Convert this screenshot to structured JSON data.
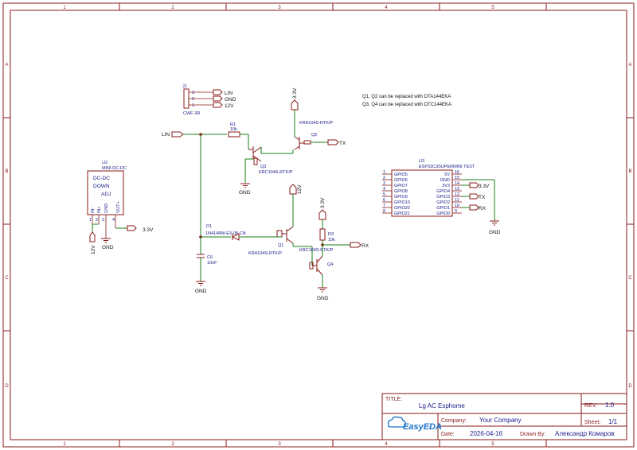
{
  "zones": {
    "cols": [
      "1",
      "2",
      "3",
      "4",
      "5"
    ],
    "rows": [
      "A",
      "B",
      "C",
      "D"
    ]
  },
  "notes": {
    "line1": "Q1, Q2 can be replaced with DTA144EKA",
    "line2": "Q3, Q4 can be replaced with DTC144EKA"
  },
  "j1": {
    "ref": "J1",
    "name": "CWF-3R",
    "pins": [
      "3",
      "2",
      "1"
    ],
    "nets": [
      "LIN",
      "GND",
      "12V"
    ]
  },
  "u2": {
    "ref": "U2",
    "name": "MINI DC-DC",
    "text1": "DC-DC",
    "text2": "DOWN",
    "text3": "ADJ",
    "pin_nums": [
      "1",
      "2",
      "3",
      "4"
    ],
    "pin_names": [
      "IN-",
      "IN+",
      "GND",
      "OUT+"
    ],
    "net_12v": "12V",
    "net_gnd": "GND",
    "net_33": "3.3V"
  },
  "r1": {
    "ref": "R1",
    "value": "10k"
  },
  "r3": {
    "ref": "R3",
    "value": "10k"
  },
  "q1": {
    "ref": "Q1",
    "value": "KRA104S-RTK/P"
  },
  "q2": {
    "ref": "Q2",
    "value": "KRA104S-RTK/P"
  },
  "q3": {
    "ref": "Q3",
    "value": "KRC104S-RTK/P"
  },
  "q4": {
    "ref": "Q4",
    "value": "KRC104S-RTK/P"
  },
  "d1": {
    "ref": "D1",
    "value": "1N4148W-E3-08-CN"
  },
  "c6": {
    "ref": "C6",
    "value": "10nF"
  },
  "nets": {
    "lin": "LIN",
    "tx": "TX",
    "rx": "RX",
    "v33": "3.3V",
    "v12": "12V",
    "gnd": "GND"
  },
  "u3": {
    "ref": "U3",
    "name": "ESP32C3SUPERMINI TEST",
    "left_pins": [
      {
        "num": "1",
        "name": "GPIO5"
      },
      {
        "num": "2",
        "name": "GPIO6"
      },
      {
        "num": "3",
        "name": "GPIO7"
      },
      {
        "num": "4",
        "name": "GPIO8"
      },
      {
        "num": "5",
        "name": "GPIO9"
      },
      {
        "num": "6",
        "name": "GPIO10"
      },
      {
        "num": "7",
        "name": "GPIO20"
      },
      {
        "num": "8",
        "name": "GPIO21"
      }
    ],
    "right_pins": [
      {
        "num": "16",
        "name": "5V"
      },
      {
        "num": "15",
        "name": "GND"
      },
      {
        "num": "14",
        "name": "3V3"
      },
      {
        "num": "13",
        "name": "GPIO4"
      },
      {
        "num": "12",
        "name": "GPIO3"
      },
      {
        "num": "11",
        "name": "GPIO2"
      },
      {
        "num": "10",
        "name": "GPIO1"
      },
      {
        "num": "9",
        "name": "GPIO0"
      }
    ]
  },
  "title_block": {
    "title_label": "TITLE:",
    "title": "Lg AC Esphome",
    "rev_label": "REV:",
    "rev": "1.0",
    "company_label": "Company:",
    "company": "Your Company",
    "sheet_label": "Sheet:",
    "sheet": "1/1",
    "date_label": "Date:",
    "date": "2026-04-16",
    "drawn_label": "Drawn By:",
    "drawn": "Александр Комаров",
    "logo": "EasyEDA"
  },
  "colors": {
    "frame": "#8b1a1a",
    "wire": "#1a7f1a",
    "label": "#1a1a8b",
    "logo": "#1a73c9"
  }
}
